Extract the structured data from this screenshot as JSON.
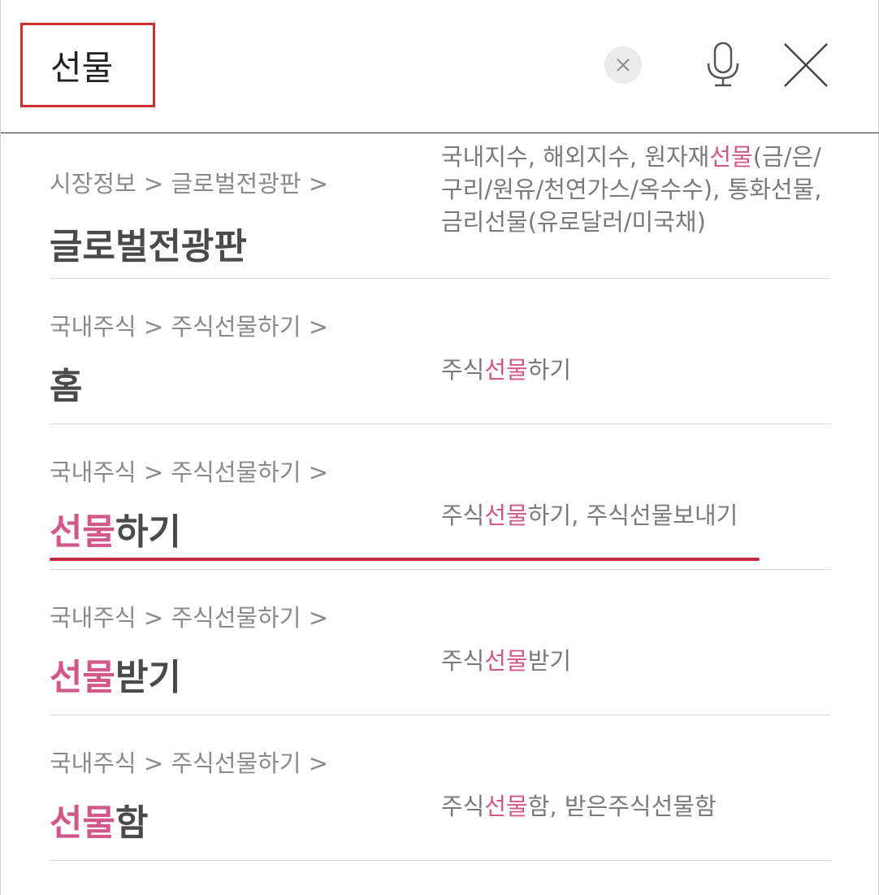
{
  "search": {
    "query": "선물",
    "accent_color": "#d0312d"
  },
  "header": {
    "clear_icon": "clear-x-icon",
    "mic_icon": "microphone-icon",
    "close_icon": "close-icon"
  },
  "highlight_color": "#d2588a",
  "results": [
    {
      "breadcrumb": "시장정보 > 글로벌전광판 >",
      "title_hl": "",
      "title_rest": "글로벌전광판",
      "desc_pre": "국내지수, 해외지수, 원자재",
      "desc_hl": "선물",
      "desc_post": "(금/은/구리/원유/천연가스/옥수수), 통화선물, 금리선물(유로달러/미국채)"
    },
    {
      "breadcrumb": "국내주식 > 주식선물하기 >",
      "title_hl": "",
      "title_rest": "홈",
      "desc_pre": "주식",
      "desc_hl": "선물",
      "desc_post": "하기"
    },
    {
      "breadcrumb": "국내주식 > 주식선물하기 >",
      "title_hl": "선물",
      "title_rest": "하기",
      "desc_pre": "주식",
      "desc_hl": "선물",
      "desc_post": "하기, 주식선물보내기"
    },
    {
      "breadcrumb": "국내주식 > 주식선물하기 >",
      "title_hl": "선물",
      "title_rest": "받기",
      "desc_pre": "주식",
      "desc_hl": "선물",
      "desc_post": "받기"
    },
    {
      "breadcrumb": "국내주식 > 주식선물하기 >",
      "title_hl": "선물",
      "title_rest": "함",
      "desc_pre": "주식",
      "desc_hl": "선물",
      "desc_post": "함, 받은주식선물함"
    }
  ]
}
